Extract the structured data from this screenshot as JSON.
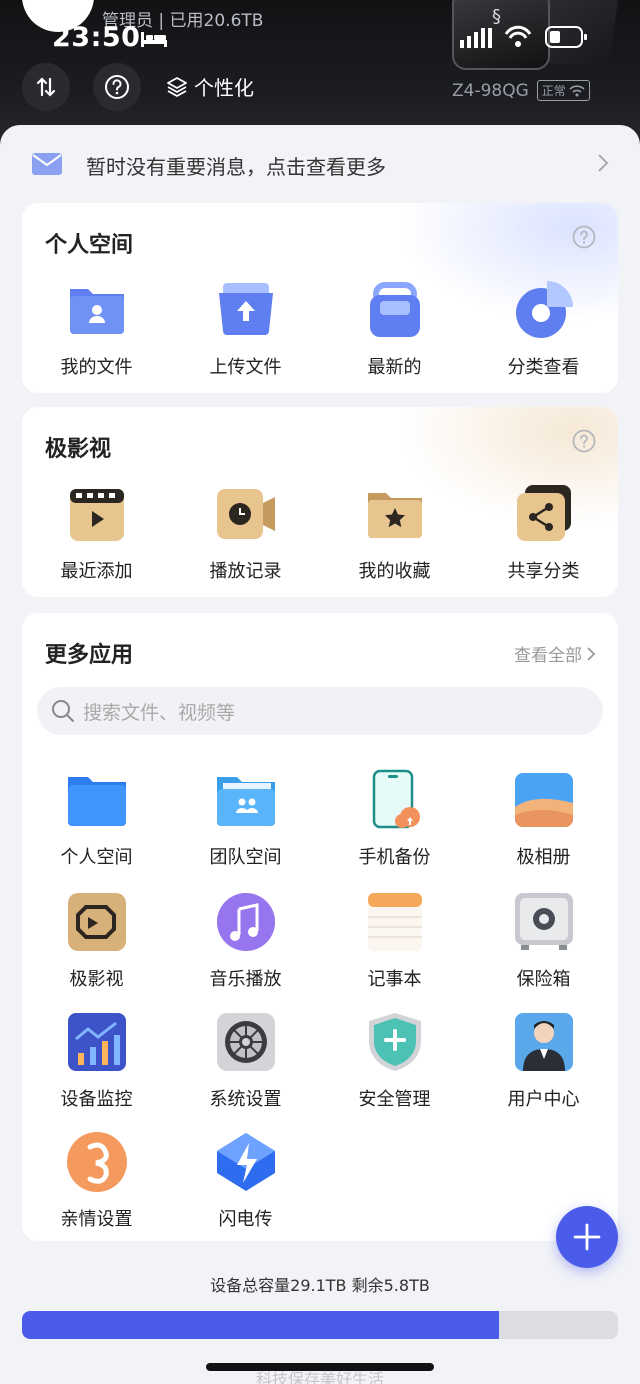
{
  "status": {
    "user_info": "管理员 | 已用20.6TB",
    "time": "23:50"
  },
  "header": {
    "personalize_label": "个性化",
    "model": "Z4-98QG",
    "network_badge": "正常"
  },
  "message": {
    "text": "暂时没有重要消息，点击查看更多"
  },
  "personal_space": {
    "title": "个人空间",
    "items": [
      {
        "label": "我的文件",
        "icon": "folder-user-icon"
      },
      {
        "label": "上传文件",
        "icon": "upload-folder-icon"
      },
      {
        "label": "最新的",
        "icon": "bag-icon"
      },
      {
        "label": "分类查看",
        "icon": "pie-chart-icon"
      }
    ]
  },
  "video": {
    "title": "极影视",
    "items": [
      {
        "label": "最近添加",
        "icon": "film-play-icon"
      },
      {
        "label": "播放记录",
        "icon": "clock-camera-icon"
      },
      {
        "label": "我的收藏",
        "icon": "star-folder-icon"
      },
      {
        "label": "共享分类",
        "icon": "share-stack-icon"
      }
    ]
  },
  "more_apps": {
    "title": "更多应用",
    "view_all": "查看全部",
    "search_placeholder": "搜索文件、视频等",
    "rows": [
      [
        {
          "label": "个人空间",
          "icon": "blue-folder-icon"
        },
        {
          "label": "团队空间",
          "icon": "team-folder-icon"
        },
        {
          "label": "手机备份",
          "icon": "phone-backup-icon"
        },
        {
          "label": "极相册",
          "icon": "photo-album-icon"
        }
      ],
      [
        {
          "label": "极影视",
          "icon": "video-app-icon"
        },
        {
          "label": "音乐播放",
          "icon": "music-icon"
        },
        {
          "label": "记事本",
          "icon": "notepad-icon"
        },
        {
          "label": "保险箱",
          "icon": "safe-icon"
        }
      ],
      [
        {
          "label": "设备监控",
          "icon": "monitor-chart-icon"
        },
        {
          "label": "系统设置",
          "icon": "gear-icon"
        },
        {
          "label": "安全管理",
          "icon": "shield-plus-icon"
        },
        {
          "label": "用户中心",
          "icon": "user-center-icon"
        }
      ],
      [
        {
          "label": "亲情设置",
          "icon": "family-icon"
        },
        {
          "label": "闪电传",
          "icon": "lightning-icon"
        }
      ]
    ]
  },
  "storage": {
    "text": "设备总容量29.1TB 剩余5.8TB",
    "used_fraction": 0.8
  },
  "footer": {
    "text": "科技保存美好生活"
  },
  "colors": {
    "accent": "#4b5bea",
    "header_bg": "#121214"
  }
}
